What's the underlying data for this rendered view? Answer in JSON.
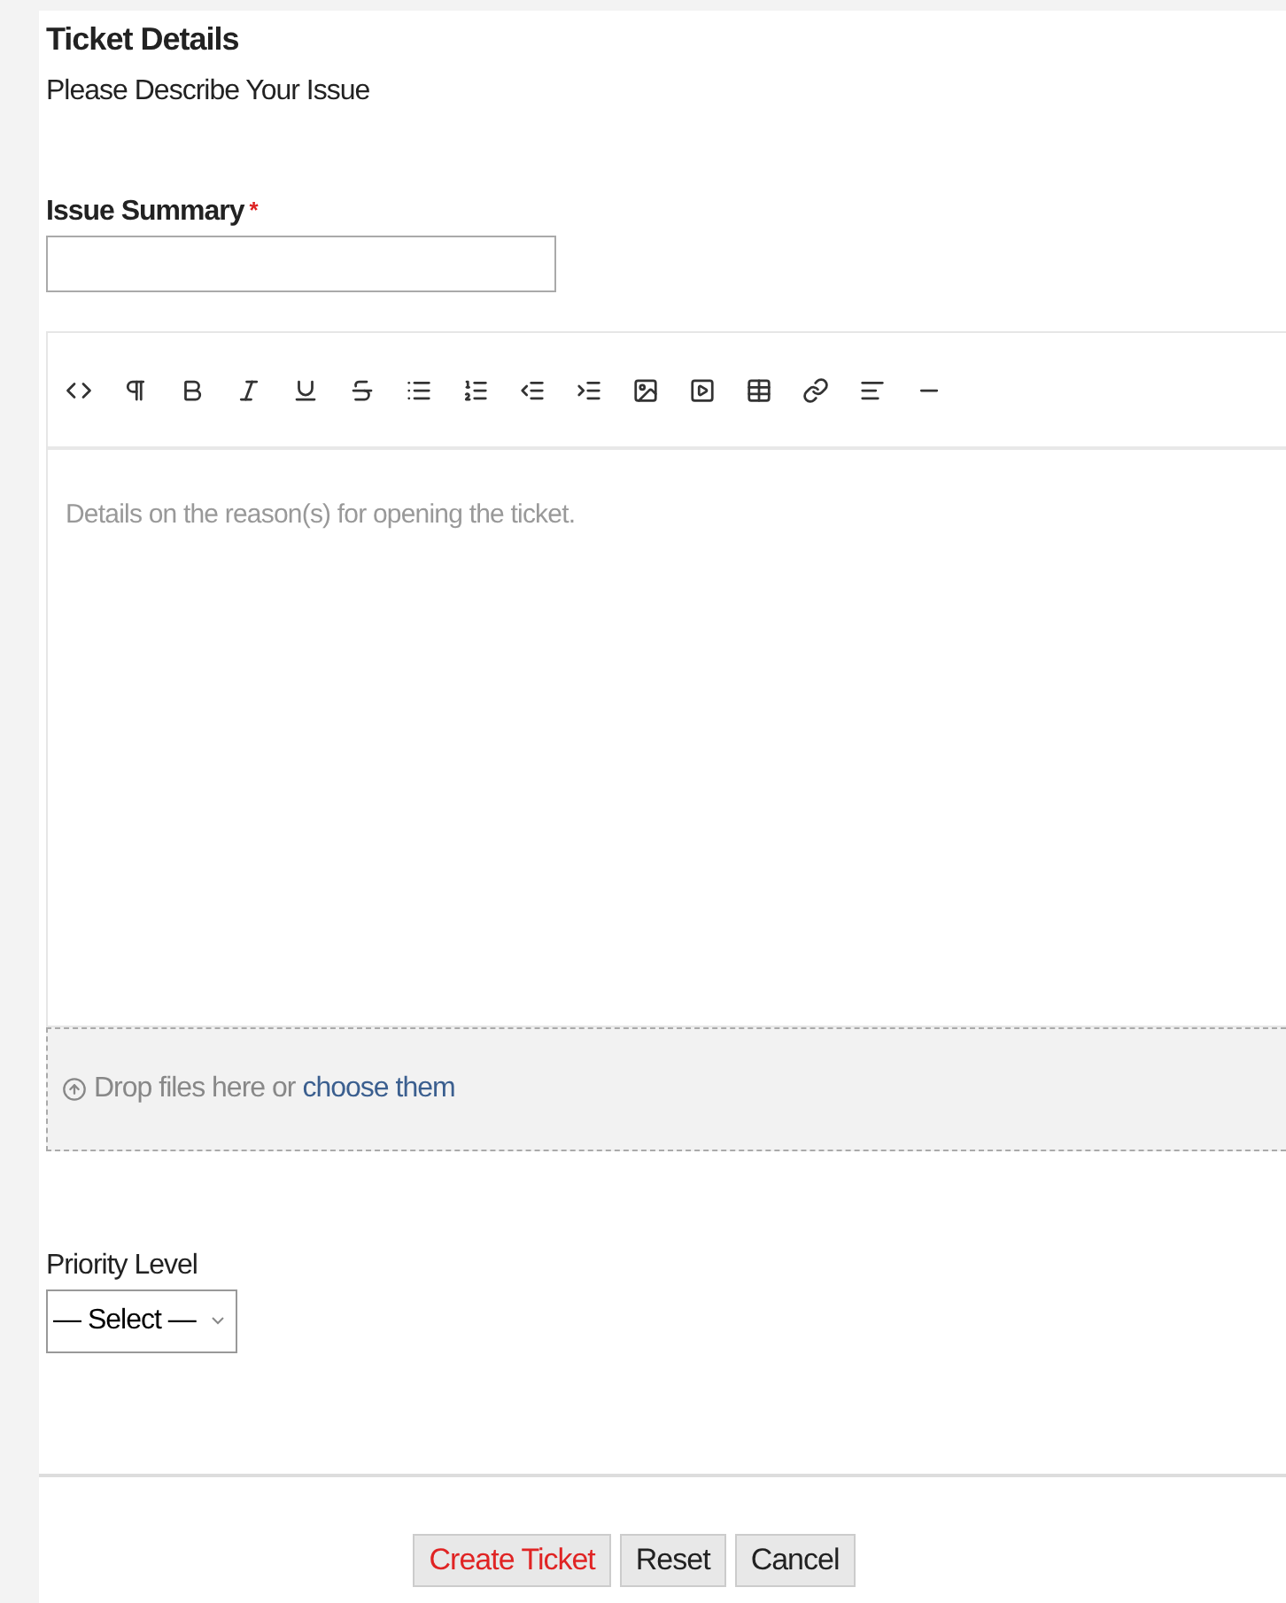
{
  "section": {
    "title": "Ticket Details",
    "subtitle": "Please Describe Your Issue"
  },
  "summary": {
    "label": "Issue Summary",
    "required_mark": "*"
  },
  "editor": {
    "placeholder": "Details on the reason(s) for opening the ticket."
  },
  "dropzone": {
    "text": "Drop files here or",
    "link": "choose them"
  },
  "priority": {
    "label": "Priority Level",
    "value": "— Select —"
  },
  "buttons": [
    {
      "label": "Create Ticket",
      "kind": "primary"
    },
    {
      "label": "Reset",
      "kind": "default"
    },
    {
      "label": "Cancel",
      "kind": "default"
    }
  ]
}
